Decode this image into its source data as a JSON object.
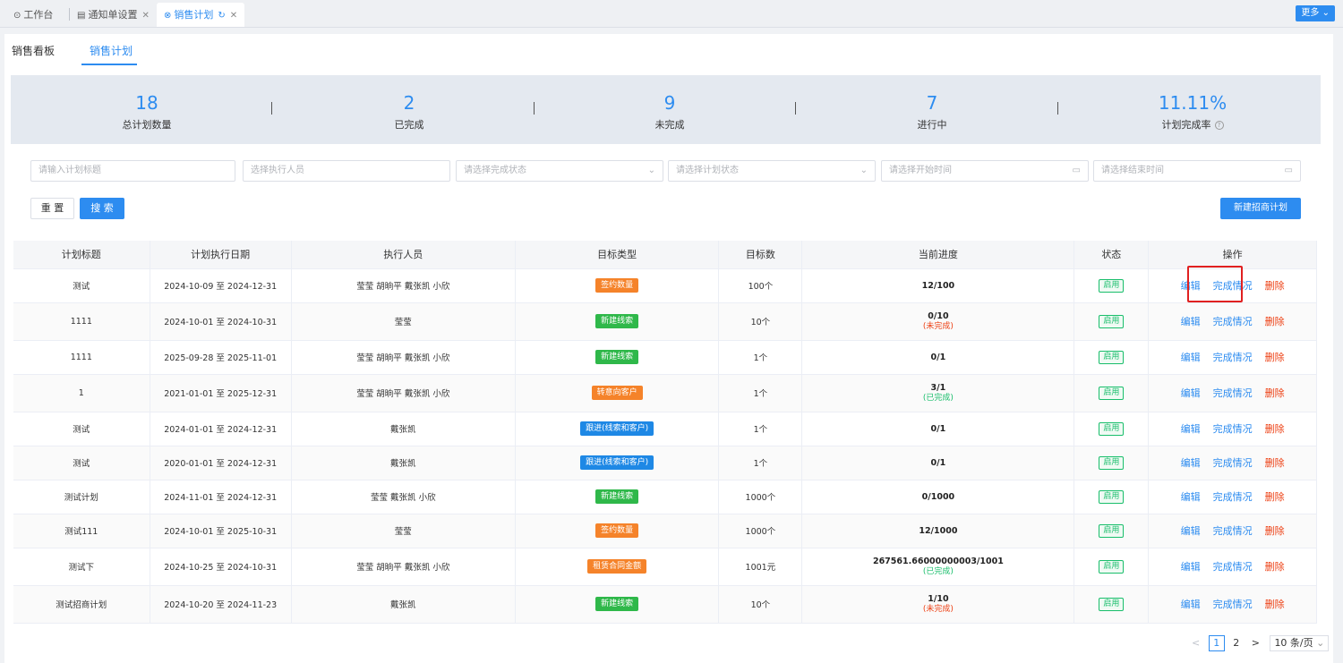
{
  "tabs": [
    {
      "icon": "⊙",
      "label": "工作台",
      "closable": false
    },
    {
      "icon": "▤",
      "label": "通知单设置",
      "closable": true
    },
    {
      "icon": "⊗",
      "label": "销售计划",
      "closable": true,
      "active": true
    }
  ],
  "more_label": "更多",
  "subtabs": [
    "销售看板",
    "销售计划"
  ],
  "stats": [
    {
      "value": "18",
      "label": "总计划数量"
    },
    {
      "value": "2",
      "label": "已完成"
    },
    {
      "value": "9",
      "label": "未完成"
    },
    {
      "value": "7",
      "label": "进行中"
    },
    {
      "value": "11.11%",
      "label": "计划完成率"
    }
  ],
  "filters": {
    "title_ph": "请输入计划标题",
    "executor_ph": "选择执行人员",
    "complete_status_ph": "请选择完成状态",
    "plan_status_ph": "请选择计划状态",
    "start_ph": "请选择开始时间",
    "end_ph": "请选择结束时间"
  },
  "buttons": {
    "reset": "重 置",
    "search": "搜 索",
    "new": "新建招商计划"
  },
  "table": {
    "headers": [
      "计划标题",
      "计划执行日期",
      "执行人员",
      "目标类型",
      "目标数",
      "当前进度",
      "状态",
      "操作"
    ],
    "actions": {
      "edit": "编辑",
      "done": "完成情况",
      "del": "删除"
    },
    "rows": [
      {
        "title": "测试",
        "date": "2024-10-09 至 2024-12-31",
        "people": "莹莹 胡晌平 戴张凯 小欣",
        "type": "签约数量",
        "color": "#f5832a",
        "target": "100个",
        "progress": "12/100",
        "sub": "",
        "status": "启用"
      },
      {
        "title": "1111",
        "date": "2024-10-01 至 2024-10-31",
        "people": "莹莹",
        "type": "新建线索",
        "color": "#2fb84a",
        "target": "10个",
        "progress": "0/10",
        "sub": "(未完成)",
        "sub_color": "red",
        "status": "启用"
      },
      {
        "title": "1111",
        "date": "2025-09-28 至 2025-11-01",
        "people": "莹莹 胡晌平 戴张凯 小欣",
        "type": "新建线索",
        "color": "#2fb84a",
        "target": "1个",
        "progress": "0/1",
        "sub": "",
        "status": "启用"
      },
      {
        "title": "1",
        "date": "2021-01-01 至 2025-12-31",
        "people": "莹莹 胡晌平 戴张凯 小欣",
        "type": "转意向客户",
        "color": "#f5832a",
        "target": "1个",
        "progress": "3/1",
        "sub": "(已完成)",
        "sub_color": "green",
        "status": "启用"
      },
      {
        "title": "测试",
        "date": "2024-01-01 至 2024-12-31",
        "people": "戴张凯",
        "type": "跟进(线索和客户)",
        "color": "#1e88e5",
        "target": "1个",
        "progress": "0/1",
        "sub": "",
        "status": "启用"
      },
      {
        "title": "测试",
        "date": "2020-01-01 至 2024-12-31",
        "people": "戴张凯",
        "type": "跟进(线索和客户)",
        "color": "#1e88e5",
        "target": "1个",
        "progress": "0/1",
        "sub": "",
        "status": "启用"
      },
      {
        "title": "测试计划",
        "date": "2024-11-01 至 2024-12-31",
        "people": "莹莹 戴张凯 小欣",
        "type": "新建线索",
        "color": "#2fb84a",
        "target": "1000个",
        "progress": "0/1000",
        "sub": "",
        "status": "启用"
      },
      {
        "title": "测试111",
        "date": "2024-10-01 至 2025-10-31",
        "people": "莹莹",
        "type": "签约数量",
        "color": "#f5832a",
        "target": "1000个",
        "progress": "12/1000",
        "sub": "",
        "status": "启用"
      },
      {
        "title": "测试下",
        "date": "2024-10-25 至 2024-10-31",
        "people": "莹莹 胡晌平 戴张凯 小欣",
        "type": "租赁合同金额",
        "color": "#f5832a",
        "target": "1001元",
        "progress": "267561.66000000003/1001",
        "sub": "(已完成)",
        "sub_color": "green",
        "status": "启用"
      },
      {
        "title": "测试招商计划",
        "date": "2024-10-20 至 2024-11-23",
        "people": "戴张凯",
        "type": "新建线索",
        "color": "#2fb84a",
        "target": "10个",
        "progress": "1/10",
        "sub": "(未完成)",
        "sub_color": "red",
        "status": "启用"
      }
    ]
  },
  "pager": {
    "prev": "<",
    "current": "1",
    "next_page": "2",
    "next": ">",
    "size": "10 条/页"
  }
}
